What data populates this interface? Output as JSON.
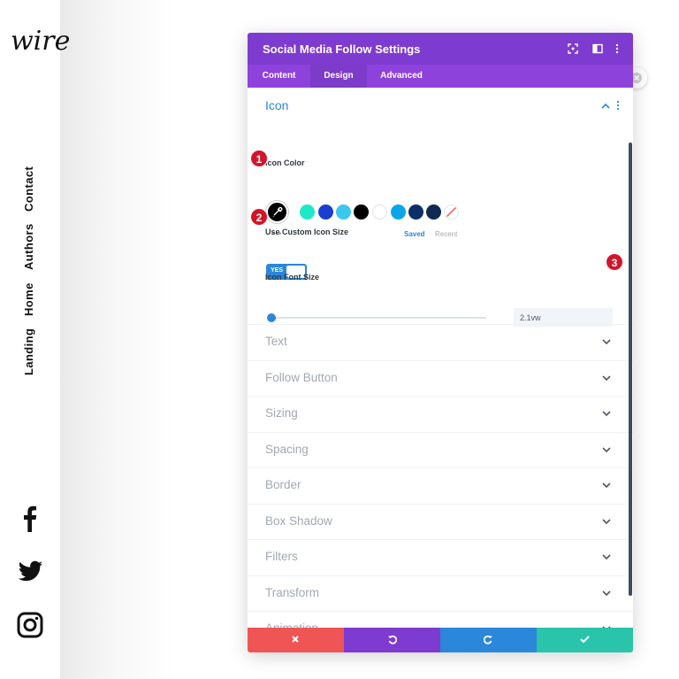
{
  "site": {
    "logo_text": "wire",
    "nav": [
      "Contact",
      "Authors",
      "Home",
      "Landing"
    ],
    "social_icons": [
      "facebook-icon",
      "twitter-icon",
      "instagram-icon"
    ]
  },
  "modal": {
    "title": "Social Media Follow Settings",
    "header_icons": [
      "expand-icon",
      "split-view-icon",
      "more-options-icon"
    ],
    "tabs": [
      {
        "label": "Content",
        "active": false
      },
      {
        "label": "Design",
        "active": true
      },
      {
        "label": "Advanced",
        "active": false
      }
    ]
  },
  "icon_section": {
    "title": "Icon",
    "icon_color": {
      "label": "Icon Color",
      "selected_color": "#000000",
      "swatches": [
        "#1de9c7",
        "#1a3fcf",
        "#3cc7f0",
        "#000000",
        "#ffffff",
        "#0ba5ec",
        "#0d2e6b",
        "#0f2a52",
        "transparent"
      ],
      "dots": "•••",
      "saved_label": "Saved",
      "recent_label": "Recent"
    },
    "custom_size": {
      "label": "Use Custom Icon Size",
      "toggle_label": "YES",
      "enabled": true
    },
    "font_size": {
      "label": "Icon Font Size",
      "value": "2.1vw",
      "slider_level": 0.02
    }
  },
  "badges": [
    "1",
    "2",
    "3"
  ],
  "groups": [
    "Text",
    "Follow Button",
    "Sizing",
    "Spacing",
    "Border",
    "Box Shadow",
    "Filters",
    "Transform",
    "Animation"
  ],
  "footer": {
    "buttons": [
      "cancel-button",
      "undo-button",
      "redo-button",
      "save-button"
    ],
    "colors": {
      "cancel": "#ef5555",
      "undo": "#7e3bd0",
      "redo": "#2b87da",
      "save": "#29c4a9"
    }
  },
  "colors": {
    "header": "#7e3bd0",
    "tabs": "#8e42dc",
    "accent": "#2b87da",
    "badge": "#d3152a"
  }
}
